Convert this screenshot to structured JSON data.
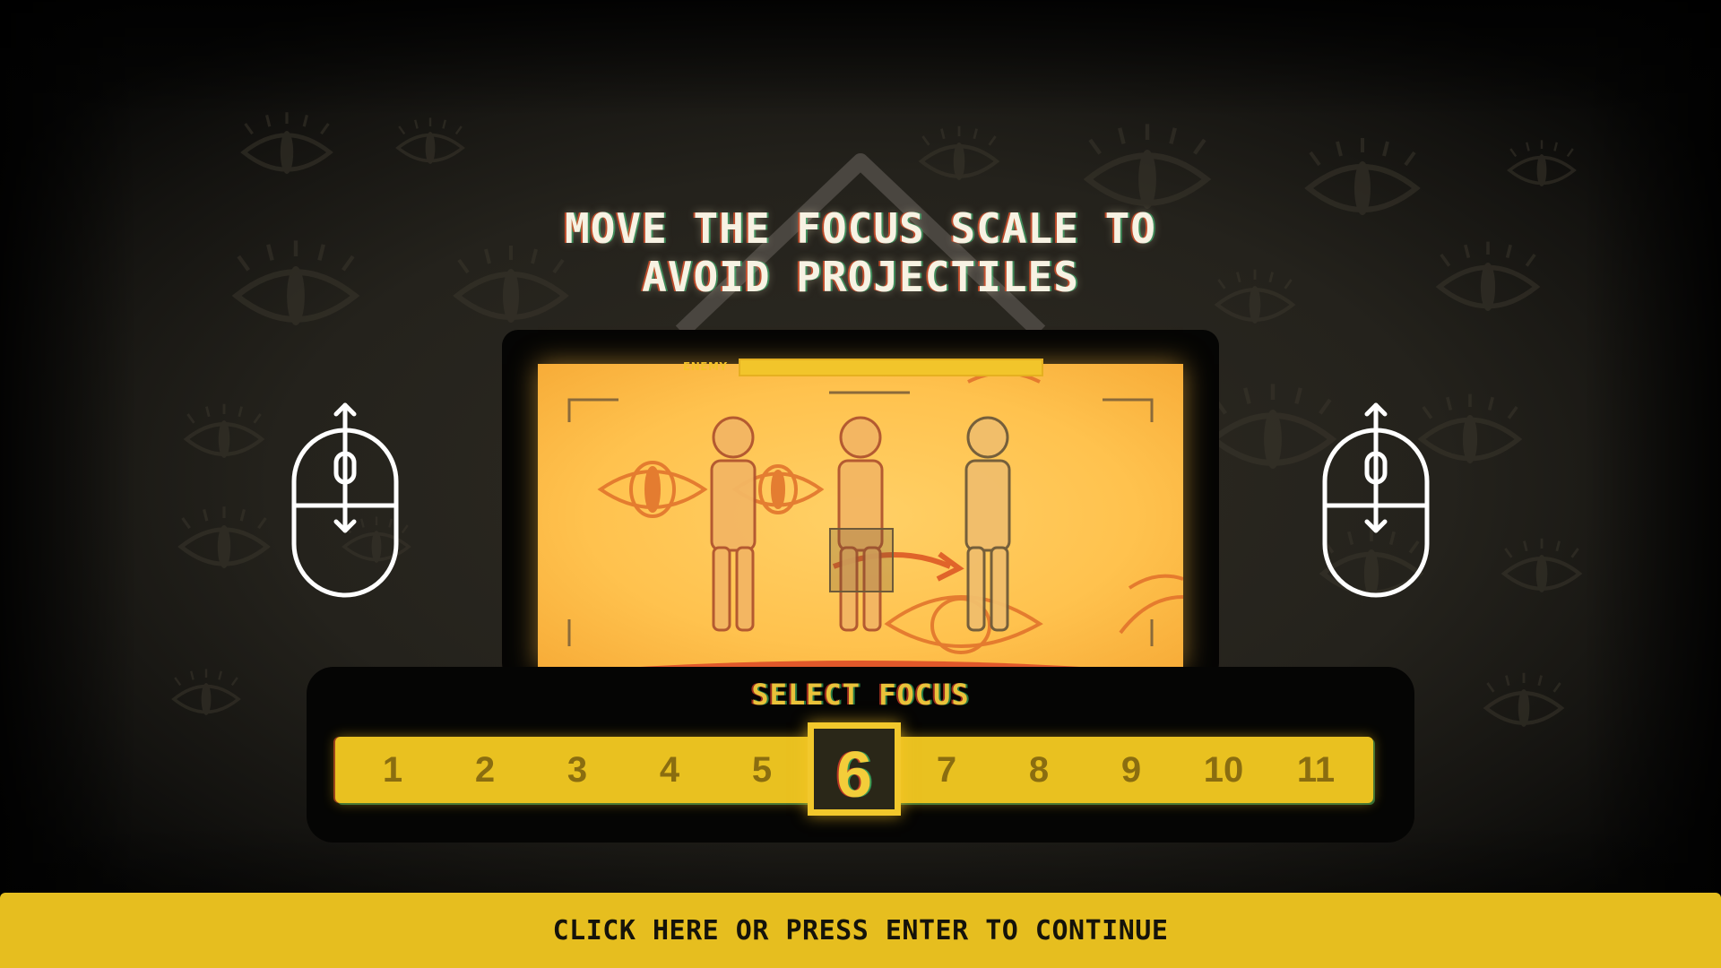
{
  "title": {
    "line1": "MOVE THE FOCUS SCALE TO",
    "line2": "AVOID PROJECTILES"
  },
  "game_screen": {
    "enemy_label": "ENEMY",
    "enemy_health": 1.0
  },
  "controls": {
    "left_icon": "mouse-scroll-icon",
    "right_icon": "mouse-scroll-icon"
  },
  "focus": {
    "label": "SELECT FOCUS",
    "options": [
      "1",
      "2",
      "3",
      "4",
      "5",
      "6",
      "7",
      "8",
      "9",
      "10",
      "11"
    ],
    "selected": "6"
  },
  "continue": {
    "label": "CLICK HERE OR PRESS ENTER TO CONTINUE"
  },
  "colors": {
    "accent_yellow": "#e6be1f",
    "screen_orange": "#ffc24e",
    "background": "#24221c"
  }
}
